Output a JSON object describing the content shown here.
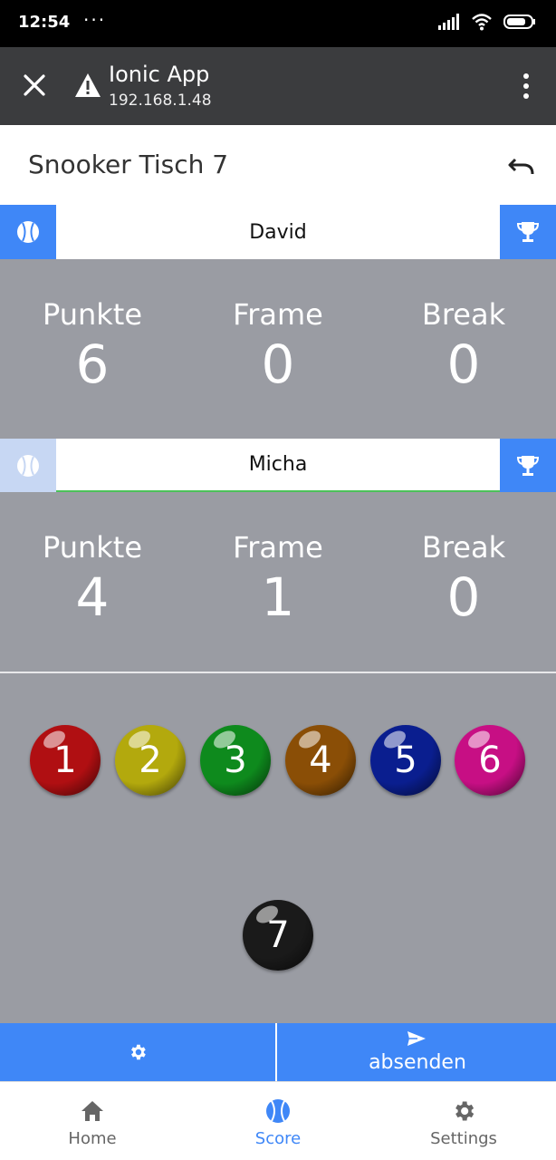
{
  "status_bar": {
    "time": "12:54",
    "dots": "···"
  },
  "browser": {
    "title": "Ionic App",
    "url": "192.168.1.48"
  },
  "header": {
    "title": "Snooker Tisch 7"
  },
  "players": [
    {
      "name": "David",
      "punkte_label": "Punkte",
      "frame_label": "Frame",
      "break_label": "Break",
      "punkte": "6",
      "frame": "0",
      "break": "0"
    },
    {
      "name": "Micha",
      "punkte_label": "Punkte",
      "frame_label": "Frame",
      "break_label": "Break",
      "punkte": "4",
      "frame": "1",
      "break": "0"
    }
  ],
  "balls": [
    {
      "label": "1",
      "color": "#b00f12"
    },
    {
      "label": "2",
      "color": "#b3a90d"
    },
    {
      "label": "3",
      "color": "#0e8a1d"
    },
    {
      "label": "4",
      "color": "#8a4e06"
    },
    {
      "label": "5",
      "color": "#0a1e8f"
    },
    {
      "label": "6",
      "color": "#c70f84"
    },
    {
      "label": "7",
      "color": "#1a1a1a"
    }
  ],
  "actions": {
    "send_label": "absenden"
  },
  "tabs": [
    {
      "label": "Home"
    },
    {
      "label": "Score"
    },
    {
      "label": "Settings"
    }
  ],
  "colors": {
    "accent": "#3f87f7",
    "active_underline": "#4cc15a"
  }
}
